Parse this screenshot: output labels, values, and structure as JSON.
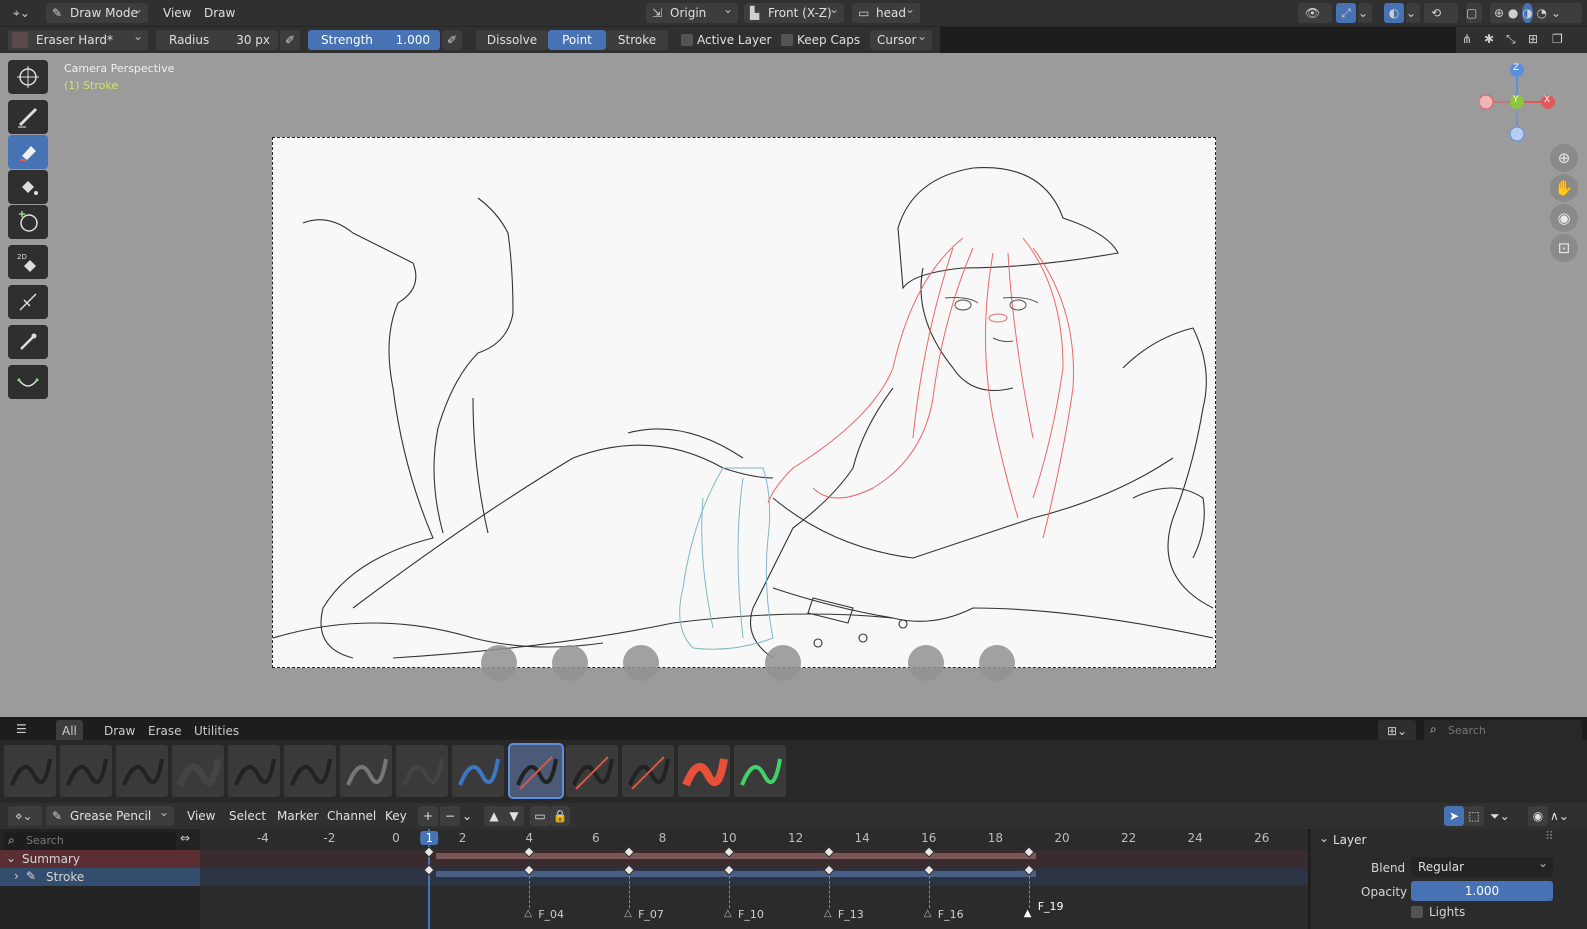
{
  "header": {
    "mode": "Draw Mode",
    "menus": [
      "View",
      "Draw"
    ],
    "pivot": "Origin",
    "view_align": "Front (X-Z)",
    "object": "head"
  },
  "tool_settings": {
    "brush": "Eraser Hard*",
    "radius_label": "Radius",
    "radius_value": "30 px",
    "strength_label": "Strength",
    "strength_value": "1.000",
    "modes": [
      "Dissolve",
      "Point",
      "Stroke"
    ],
    "active_mode": "Point",
    "active_layer": "Active Layer",
    "keep_caps": "Keep Caps",
    "cursor": "Cursor"
  },
  "viewport": {
    "overlay_line1": "Camera Perspective",
    "overlay_line2": "(1) Stroke",
    "gizmo": {
      "z": "Z",
      "y": "Y",
      "x": "X"
    },
    "tools": [
      "cursor-icon",
      "draw-icon",
      "erase-icon",
      "fill-icon",
      "circle-icon",
      "tint-icon",
      "cutter-icon",
      "eyedropper-icon",
      "curve-icon"
    ]
  },
  "assets": {
    "tabs": [
      "All",
      "Draw",
      "Erase",
      "Utilities"
    ],
    "active_tab": "All",
    "search_placeholder": "Search"
  },
  "dopesheet": {
    "editor": "Grease Pencil",
    "menus": [
      "View",
      "Select",
      "Marker",
      "Channel",
      "Key"
    ],
    "search_placeholder": "Search",
    "ticks": [
      "-4",
      "-2",
      "0",
      "1",
      "2",
      "4",
      "6",
      "8",
      "10",
      "12",
      "14",
      "16",
      "18",
      "20",
      "22",
      "24",
      "26"
    ],
    "current_frame": "1",
    "channels": [
      "Summary",
      "Stroke"
    ],
    "markers": [
      "F_04",
      "F_07",
      "F_10",
      "F_13",
      "F_16",
      "F_19"
    ]
  },
  "layer_panel": {
    "title": "Layer",
    "blend_label": "Blend",
    "blend_value": "Regular",
    "opacity_label": "Opacity",
    "opacity_value": "1.000",
    "lights_label": "Lights"
  }
}
